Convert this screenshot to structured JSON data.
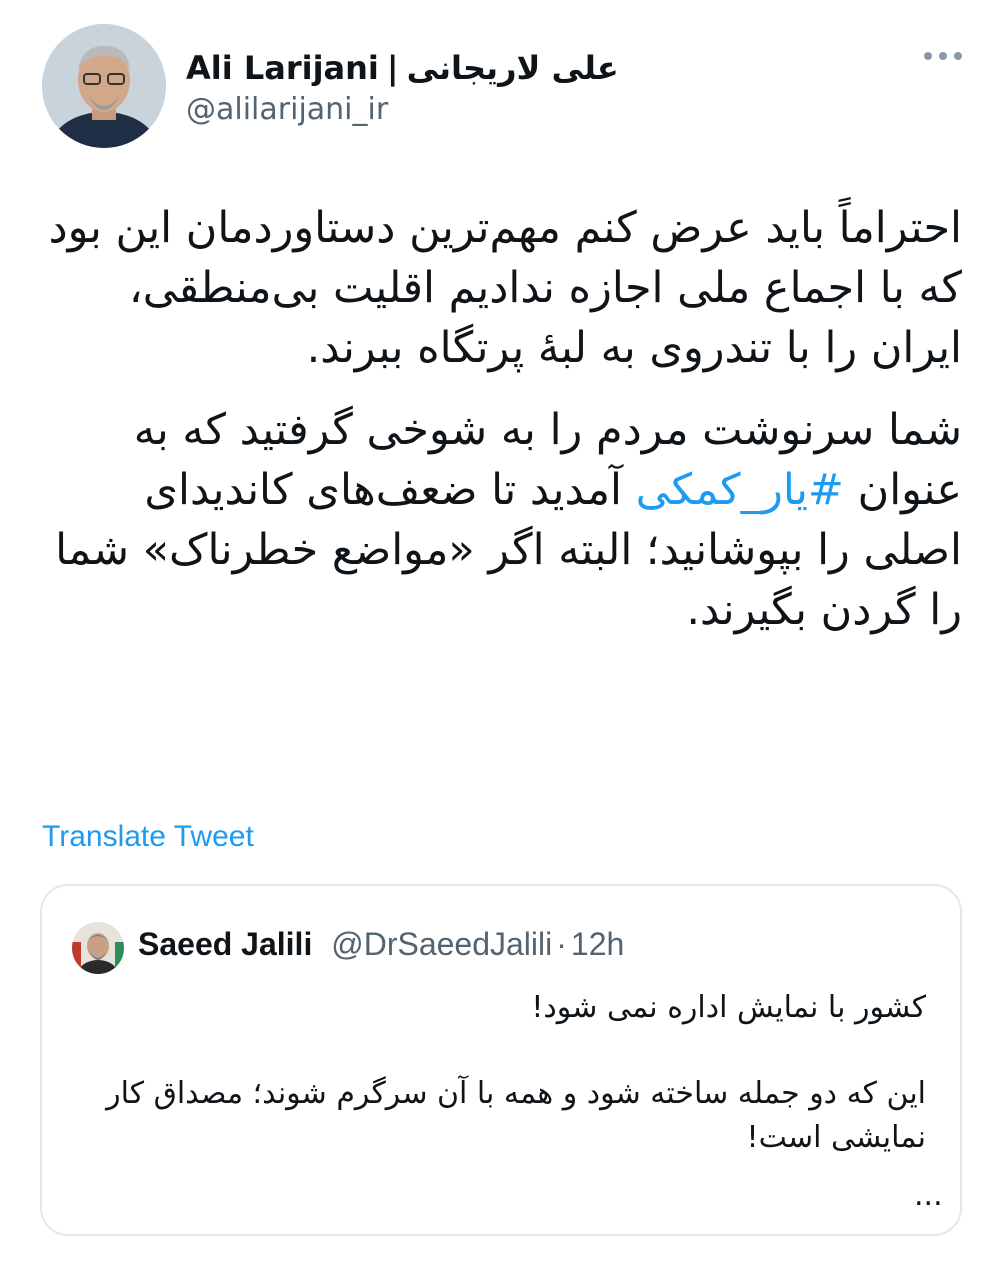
{
  "author": {
    "name": "Ali Larijani",
    "name_fa": "علی لاریجانی",
    "separator": "|",
    "handle": "@alilarijani_ir"
  },
  "tweet": {
    "paragraph1": "احتراماً باید عرض کنم مهم‌ترین دستاوردمان این بود که با اجماع ملی اجازه ندادیم اقلیت بی‌منطقی، ایران را با تندروی به لبهٔ پرتگاه ببرند.",
    "paragraph2_start": "شما سرنوشت مردم را به شوخی گرفتید که به عنوان ",
    "hashtag": "#یار_کمکی",
    "paragraph2_end": " آمدید تا ضعف‌های کاندیدای اصلی را بپوشانید؛ البته اگر «مواضع خطرناک» شما را گردن بگیرند."
  },
  "translate_label": "Translate Tweet",
  "quote": {
    "name": "Saeed Jalili",
    "handle": "@DrSaeedJalili",
    "dot": "·",
    "time": "12h",
    "line1": "کشور با نمایش اداره نمی شود!",
    "line2": "این که دو جمله ساخته شود و همه با آن سرگرم شوند؛ مصداق کار نمایشی است!",
    "ellipsis": "..."
  },
  "colors": {
    "link": "#1d9bf0",
    "secondary_text": "#536471",
    "border": "#e1e8ed"
  }
}
